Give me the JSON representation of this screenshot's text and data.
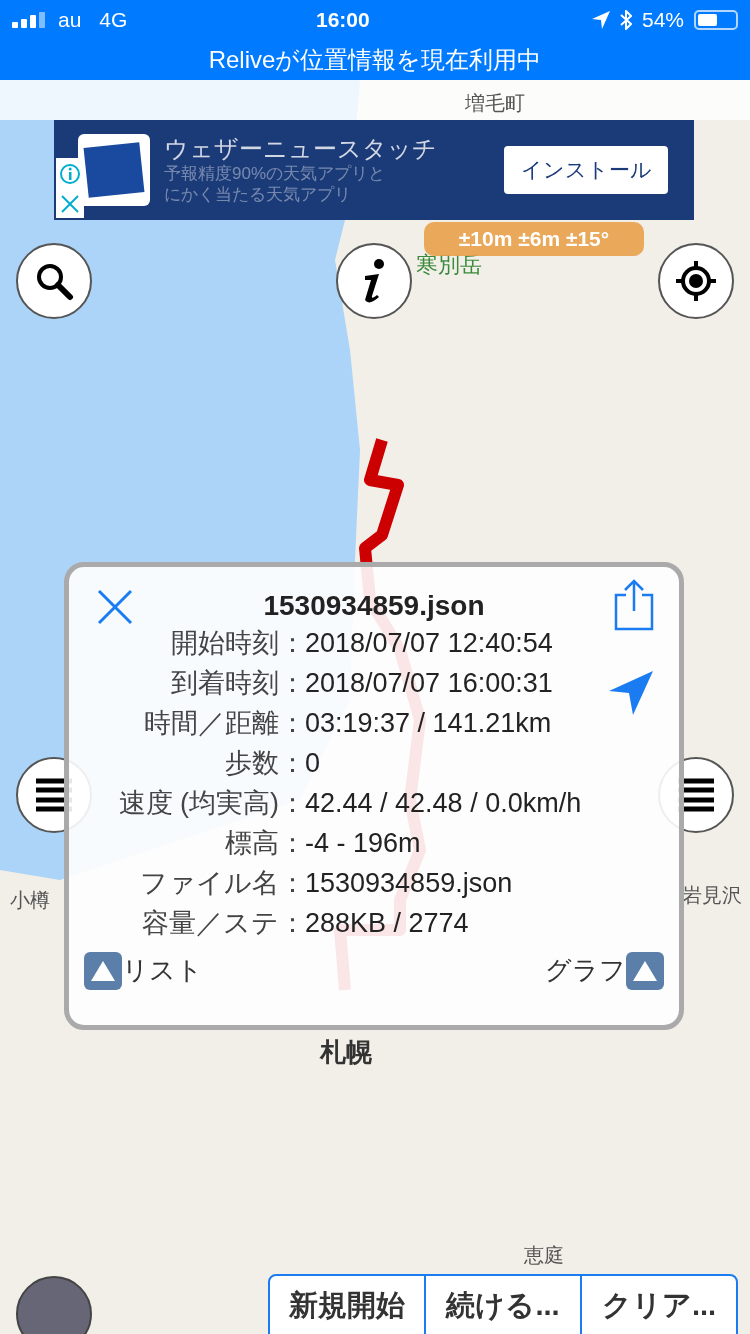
{
  "status_bar": {
    "carrier": "au",
    "network": "4G",
    "time": "16:00",
    "battery": "54%"
  },
  "location_banner": "Reliveが位置情報を現在利用中",
  "ad": {
    "title": "ウェザーニュースタッチ",
    "description": [
      "予報精度90%の天気アプリと",
      "にかく当たる天気アプリ"
    ],
    "button": "インストール"
  },
  "accuracy_badge": "±10m ±6m ±15°",
  "map_labels": [
    {
      "text": "増毛町",
      "kind": "town"
    },
    {
      "text": "寒別岳",
      "kind": "peak"
    },
    {
      "text": "小樽",
      "kind": "town"
    },
    {
      "text": "岩見沢",
      "kind": "town"
    },
    {
      "text": "札幌",
      "kind": "city"
    },
    {
      "text": "恵庭",
      "kind": "town"
    }
  ],
  "info_panel": {
    "title": "1530934859.json",
    "rows": [
      {
        "label": "開始時刻",
        "value": "2018/07/07 12:40:54"
      },
      {
        "label": "到着時刻",
        "value": "2018/07/07 16:00:31"
      },
      {
        "label": "時間／距離",
        "value": "03:19:37 / 141.21km"
      },
      {
        "label": "歩数",
        "value": "0"
      },
      {
        "label": "速度 (均実高)",
        "value": "42.44 / 42.48 / 0.0km/h"
      },
      {
        "label": "標高",
        "value": "-4 - 196m"
      },
      {
        "label": "ファイル名",
        "value": "1530934859.json"
      },
      {
        "label": "容量／ステ",
        "value": "288KB / 2774"
      }
    ],
    "separator": "：",
    "list_link": "リスト",
    "graph_link": "グラフ"
  },
  "bottom_buttons": [
    "新規開始",
    "続ける...",
    "クリア..."
  ]
}
